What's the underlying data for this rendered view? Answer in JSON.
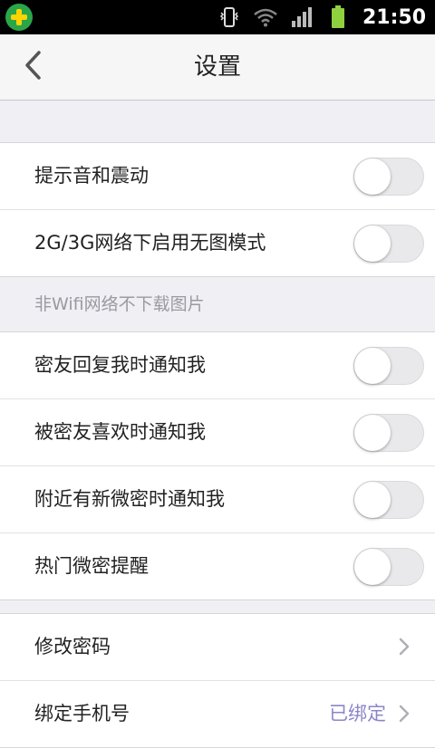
{
  "status_bar": {
    "time": "21:50",
    "icons": [
      "vibrate-icon",
      "wifi-icon",
      "signal-icon",
      "battery-icon"
    ]
  },
  "header": {
    "title": "设置",
    "back_icon": "chevron-left-icon"
  },
  "sections": {
    "group1": [
      {
        "label": "提示音和震动",
        "enabled": false
      },
      {
        "label": "2G/3G网络下启用无图模式",
        "enabled": false
      }
    ],
    "hint": "非Wifi网络不下载图片",
    "group2": [
      {
        "label": "密友回复我时通知我",
        "enabled": false
      },
      {
        "label": "被密友喜欢时通知我",
        "enabled": false
      },
      {
        "label": "附近有新微密时通知我",
        "enabled": false
      },
      {
        "label": "热门微密提醒",
        "enabled": false
      }
    ],
    "group3": [
      {
        "label": "修改密码",
        "value": ""
      },
      {
        "label": "绑定手机号",
        "value": "已绑定"
      }
    ]
  },
  "colors": {
    "background": "#efeff4",
    "value_text": "#8a86c8",
    "hint_text": "#9a9aa0"
  }
}
